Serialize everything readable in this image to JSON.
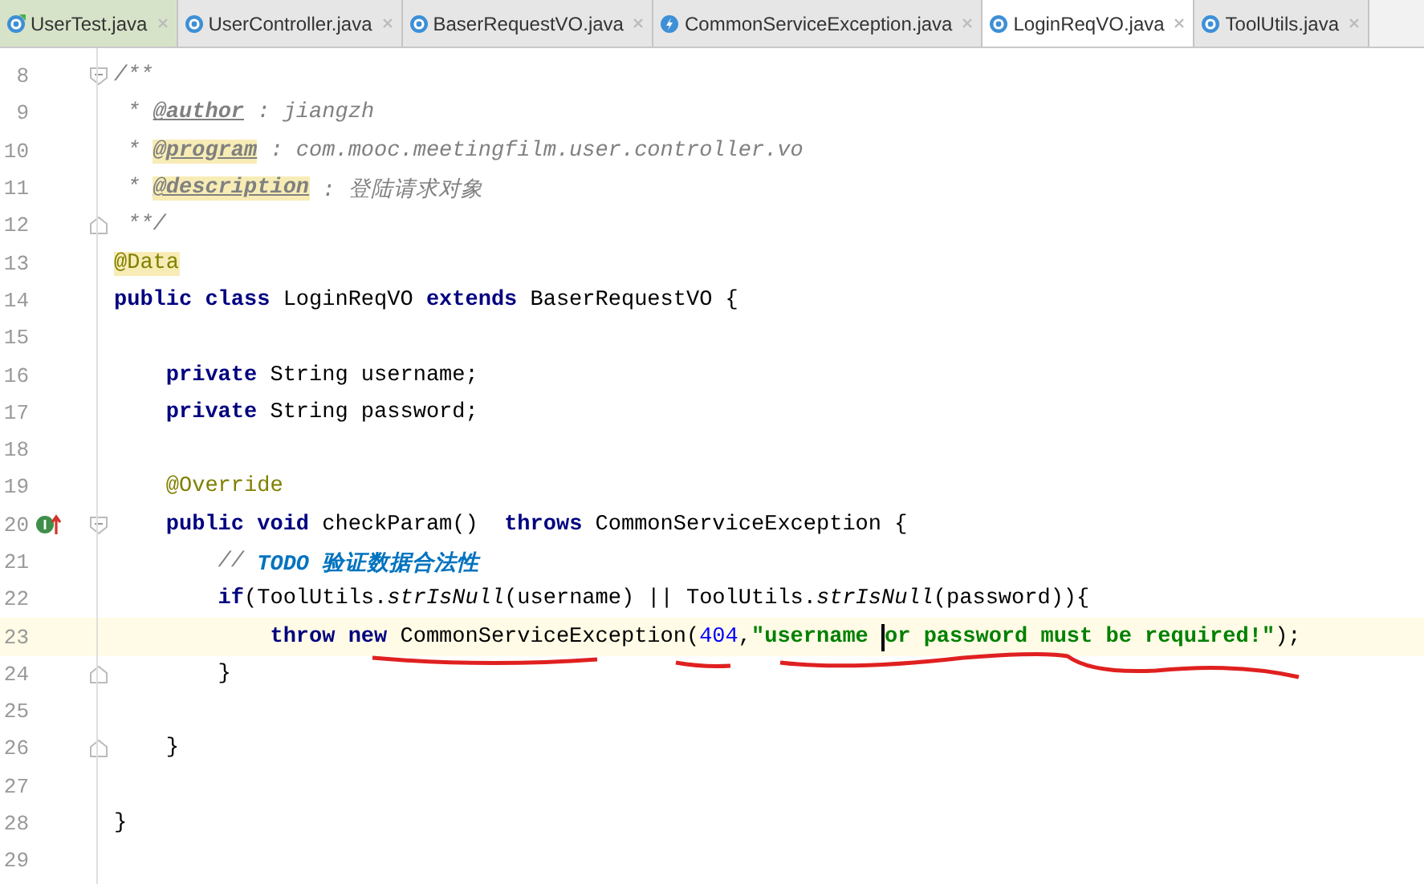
{
  "tabs": [
    {
      "label": "UserTest.java",
      "kind": "test",
      "selected": false
    },
    {
      "label": "UserController.java",
      "kind": "class",
      "selected": false
    },
    {
      "label": "BaserRequestVO.java",
      "kind": "class",
      "selected": false
    },
    {
      "label": "CommonServiceException.java",
      "kind": "exception",
      "selected": false
    },
    {
      "label": "LoginReqVO.java",
      "kind": "class",
      "selected": true
    },
    {
      "label": "ToolUtils.java",
      "kind": "class",
      "selected": false
    }
  ],
  "lines": [
    {
      "number": "8",
      "fold_start": true,
      "tokens": [
        {
          "kind": "comment",
          "text": "/**"
        }
      ]
    },
    {
      "number": "9",
      "tokens": [
        {
          "kind": "comment",
          "text": " * "
        },
        {
          "kind": "doctag",
          "text": "@author"
        },
        {
          "kind": "comment",
          "text": " : jiangzh"
        }
      ]
    },
    {
      "number": "10",
      "tokens": [
        {
          "kind": "comment",
          "text": " * "
        },
        {
          "kind": "doctag",
          "text": "@program",
          "highlighted": true
        },
        {
          "kind": "comment",
          "text": " : com.mooc.meetingfilm.user.controller.vo"
        }
      ]
    },
    {
      "number": "11",
      "tokens": [
        {
          "kind": "comment",
          "text": " * "
        },
        {
          "kind": "doctag",
          "text": "@description",
          "highlighted": true
        },
        {
          "kind": "comment",
          "text": " : 登陆请求对象"
        }
      ]
    },
    {
      "number": "12",
      "fold_end": true,
      "tokens": [
        {
          "kind": "comment",
          "text": " **/"
        }
      ]
    },
    {
      "number": "13",
      "tokens": [
        {
          "kind": "annotation",
          "text": "@Data",
          "highlighted": true
        }
      ]
    },
    {
      "number": "14",
      "tokens": [
        {
          "kind": "keyword",
          "text": "public"
        },
        {
          "kind": "keyword",
          "text": " class"
        },
        {
          "kind": "plain",
          "text": " LoginReqVO "
        },
        {
          "kind": "keyword",
          "text": "extends"
        },
        {
          "kind": "plain",
          "text": " BaserRequestVO {"
        }
      ]
    },
    {
      "number": "15"
    },
    {
      "number": "16",
      "tokens": [
        {
          "kind": "keyword",
          "text": "    private"
        },
        {
          "kind": "plain",
          "text": " String username;"
        }
      ]
    },
    {
      "number": "17",
      "tokens": [
        {
          "kind": "keyword",
          "text": "    private"
        },
        {
          "kind": "plain",
          "text": " String password;"
        }
      ]
    },
    {
      "number": "18"
    },
    {
      "number": "19",
      "tokens": [
        {
          "kind": "annotation",
          "text": "    @Override"
        }
      ]
    },
    {
      "number": "20",
      "fold_start": true,
      "override": true,
      "tokens": [
        {
          "kind": "keyword",
          "text": "    public"
        },
        {
          "kind": "keyword",
          "text": " void"
        },
        {
          "kind": "plain",
          "text": " checkParam()  "
        },
        {
          "kind": "keyword",
          "text": "throws"
        },
        {
          "kind": "plain",
          "text": " CommonServiceException {"
        }
      ]
    },
    {
      "number": "21",
      "tokens": [
        {
          "kind": "comment",
          "text": "        // "
        },
        {
          "kind": "todo",
          "text": "TODO 验证数据合法性"
        }
      ]
    },
    {
      "number": "22",
      "tokens": [
        {
          "kind": "keyword",
          "text": "        if"
        },
        {
          "kind": "plain",
          "text": "(ToolUtils."
        },
        {
          "kind": "static",
          "text": "strIsNull"
        },
        {
          "kind": "plain",
          "text": "(username) || ToolUtils."
        },
        {
          "kind": "static",
          "text": "strIsNull"
        },
        {
          "kind": "plain",
          "text": "(password)){"
        }
      ]
    },
    {
      "number": "23",
      "current": true,
      "tokens": [
        {
          "kind": "keyword",
          "text": "            throw"
        },
        {
          "kind": "keyword",
          "text": " new"
        },
        {
          "kind": "plain",
          "text": " CommonServiceException("
        },
        {
          "kind": "number",
          "text": "404"
        },
        {
          "kind": "plain",
          "text": ","
        },
        {
          "kind": "string",
          "text": "\"username ",
          "cursor": true
        },
        {
          "kind": "string",
          "text": "or password must be required!\""
        },
        {
          "kind": "plain",
          "text": ");"
        }
      ]
    },
    {
      "number": "24",
      "fold_end": true,
      "tokens": [
        {
          "kind": "plain",
          "text": "        }"
        }
      ]
    },
    {
      "number": "25"
    },
    {
      "number": "26",
      "fold_end": true,
      "tokens": [
        {
          "kind": "plain",
          "text": "    }"
        }
      ]
    },
    {
      "number": "27"
    },
    {
      "number": "28",
      "tokens": [
        {
          "kind": "plain",
          "text": "}"
        }
      ]
    },
    {
      "number": "29"
    }
  ]
}
